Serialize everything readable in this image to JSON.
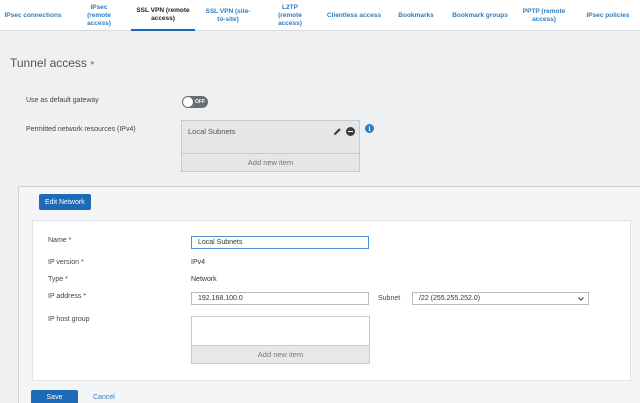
{
  "tabs": [
    {
      "label": "IPsec connections"
    },
    {
      "label": "IPsec (remote access)"
    },
    {
      "label": "SSL VPN (remote access)"
    },
    {
      "label": "SSL VPN (site-to-site)"
    },
    {
      "label": "L2TP (remote access)"
    },
    {
      "label": "Clientless access"
    },
    {
      "label": "Bookmarks"
    },
    {
      "label": "Bookmark groups"
    },
    {
      "label": "PPTP (remote access)"
    },
    {
      "label": "IPsec policies"
    }
  ],
  "active_tab": "SSL VPN (remote access)",
  "section": {
    "title": "Tunnel access",
    "marker": "•"
  },
  "gateway": {
    "label": "Use as default gateway",
    "toggle_text": "OFF",
    "enabled": false
  },
  "resources": {
    "label": "Permitted network resources (IPv4)",
    "items": [
      "Local Subnets"
    ],
    "add_label": "Add new item",
    "info_glyph": "i"
  },
  "modal": {
    "title_button": "Edit Network",
    "fields": {
      "name": {
        "label": "Name *",
        "value": "Local Subnets"
      },
      "ip_version": {
        "label": "IP version *",
        "value": "IPv4"
      },
      "type": {
        "label": "Type *",
        "value": "Network"
      },
      "ip_address": {
        "label": "IP address *",
        "value": "192.168.100.0"
      },
      "subnet": {
        "label": "Subnet",
        "value": "/22 (255.255.252.0)"
      },
      "host_group": {
        "label": "IP host group",
        "add_label": "Add new item"
      }
    },
    "save_label": "Save",
    "cancel_label": "Cancel"
  },
  "colors": {
    "accent": "#1e69b8",
    "link": "#2f7cc0",
    "toggle_off": "#6a6e73"
  }
}
